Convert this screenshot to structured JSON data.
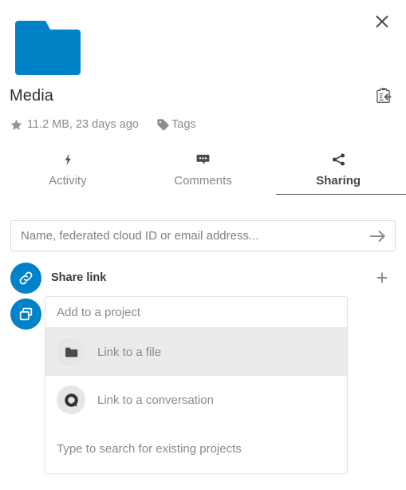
{
  "window": {
    "close_label": "×",
    "accent_color": "#0082c9",
    "background": "#ffffff"
  },
  "header": {
    "file_name": "Media",
    "file_type_icon": "folder-icon",
    "folder_color": "#0082c9",
    "details_icon": "clipboard-arrow-icon",
    "favorite_icon": "star-icon",
    "file_meta": "11.2 MB, 23 days ago",
    "tags_label": "Tags",
    "tags_icon": "tag-icon"
  },
  "tabs": [
    {
      "label": "Activity",
      "icon": "lightning-bolt-icon",
      "active": false
    },
    {
      "label": "Comments",
      "icon": "comment-bubble-icon",
      "active": false
    },
    {
      "label": "Sharing",
      "icon": "share-nodes-icon",
      "active": true
    }
  ],
  "sharing": {
    "search_placeholder": "Name, federated cloud ID or email address...",
    "search_value": "",
    "submit_icon": "arrow-right-icon",
    "rows": [
      {
        "label": "Share link",
        "icon": "link-icon",
        "action_icon": "plus-icon",
        "action_label": "+"
      },
      {
        "label": "Add to a project",
        "icon": "projects-icon"
      }
    ]
  },
  "project_picker": {
    "placeholder": "Add to a project",
    "value": "",
    "options": [
      {
        "label": "Link to a file",
        "icon": "folder-glyph-icon",
        "highlighted": true
      },
      {
        "label": "Link to a conversation",
        "icon": "talk-bubble-icon",
        "highlighted": false
      }
    ],
    "hint": "Type to search for existing projects"
  }
}
